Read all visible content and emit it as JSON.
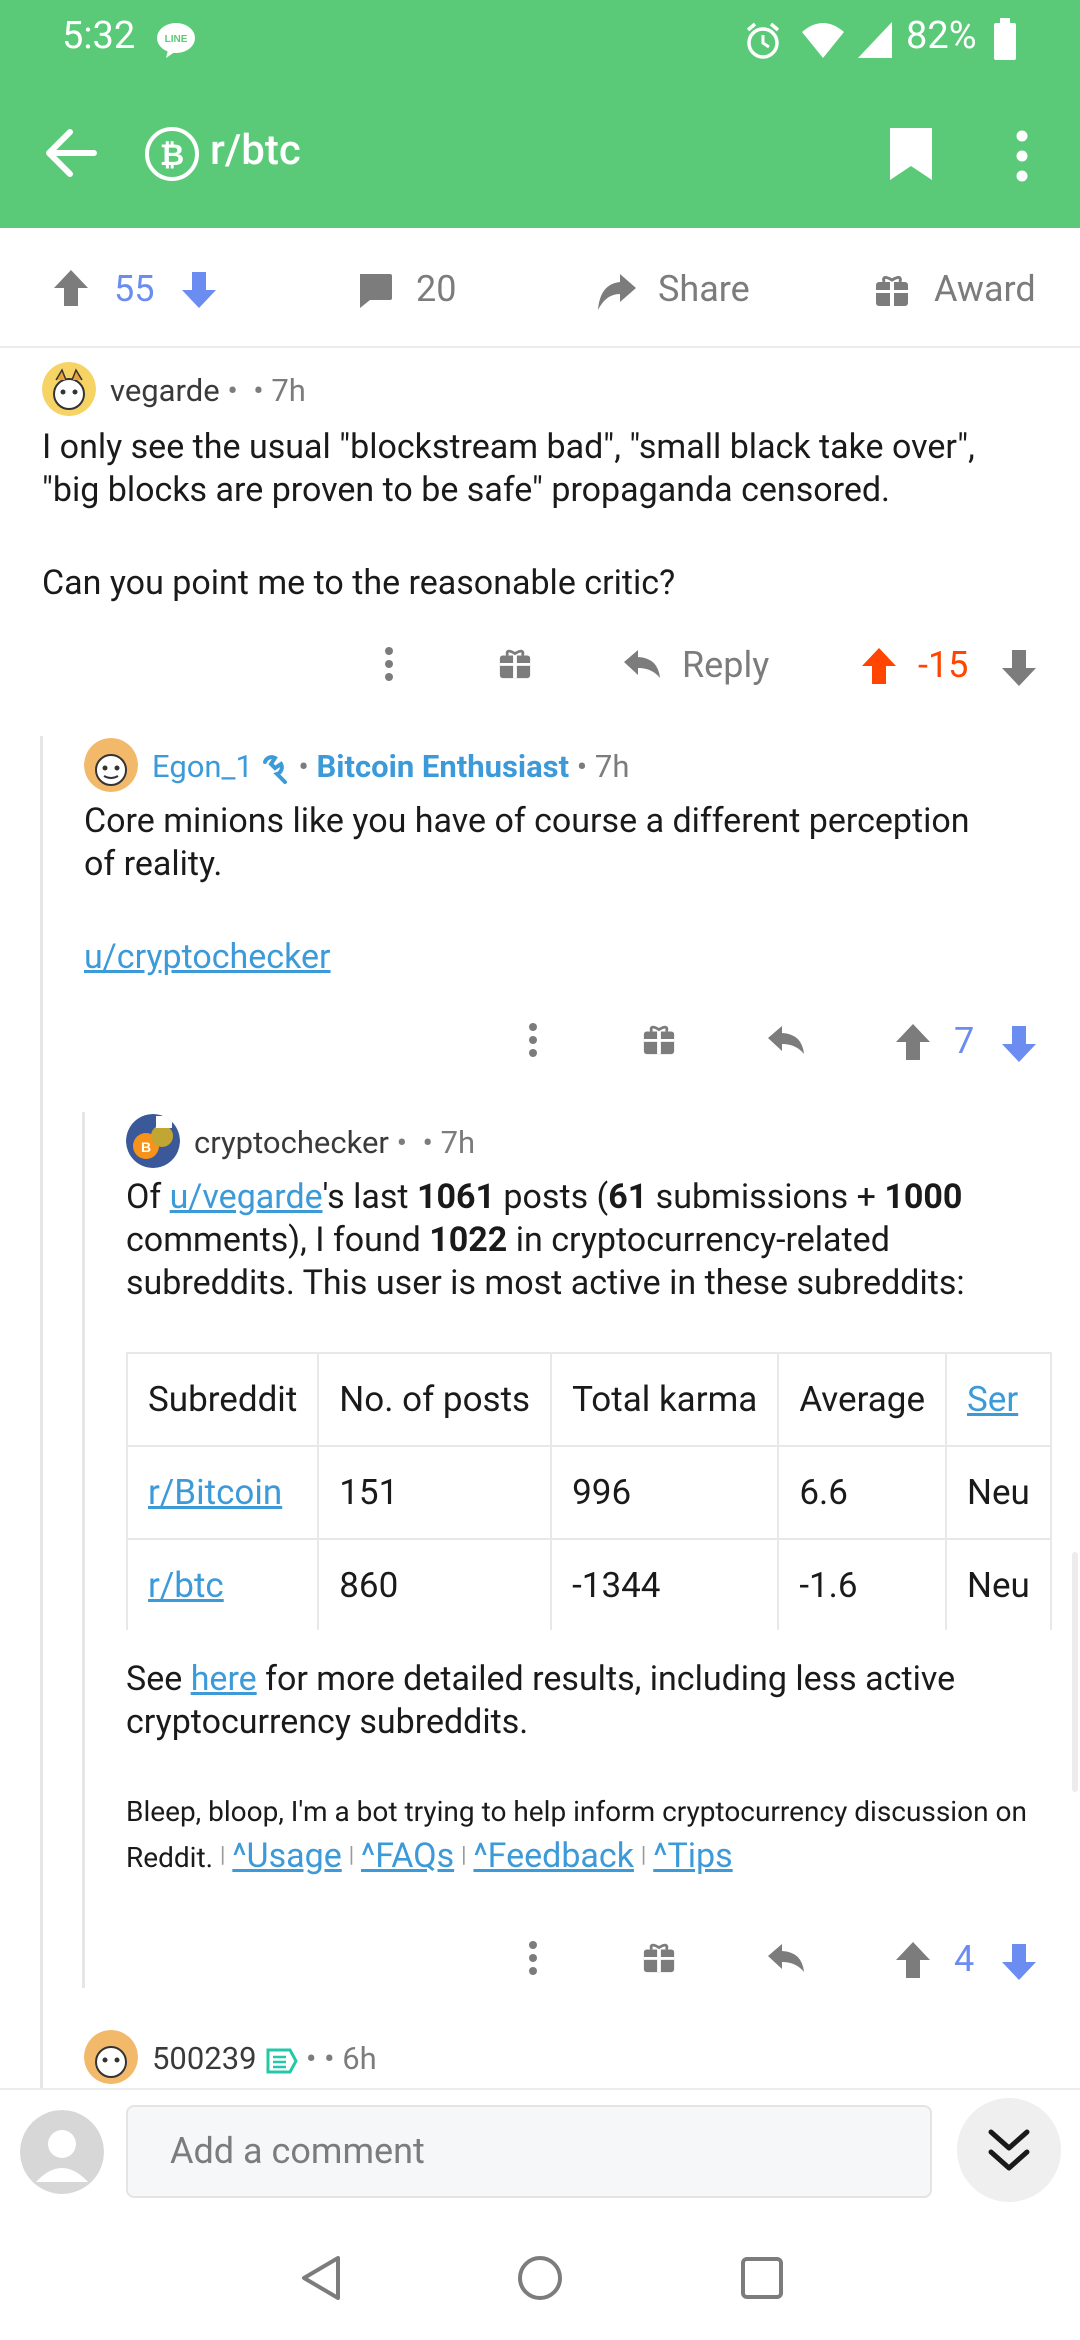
{
  "status_bar": {
    "time": "5:32",
    "battery": "82%",
    "icons": [
      "line-icon",
      "alarm-icon",
      "wifi-icon",
      "signal-icon",
      "battery-icon"
    ]
  },
  "toolbar": {
    "subreddit": "r/btc"
  },
  "post_actions": {
    "upvotes": "55",
    "comments": "20",
    "share": "Share",
    "award": "Award"
  },
  "comments": [
    {
      "author": "vegarde",
      "time": "7h",
      "body_lines": [
        "I only see the usual \"blockstream bad\", \"small black take over\",",
        "\"big blocks are proven to be safe\" propaganda censored.",
        "Can you point me to the reasonable critic?"
      ],
      "reply": "Reply",
      "score": "-15"
    },
    {
      "author": "Egon_1",
      "flair": "Bitcoin Enthusiast",
      "time": "7h",
      "body_lines": [
        "Core minions like you have of course a different perception",
        "of reality."
      ],
      "link": "u/cryptochecker",
      "score": "7"
    },
    {
      "author": "cryptochecker",
      "time": "7h",
      "intro": {
        "p1": "Of ",
        "user_link": "u/vegarde",
        "p2": "'s last ",
        "n1": "1061",
        "p3": " posts (",
        "n2": "61",
        "p4": " submissions + ",
        "n3": "1000",
        "line2a": "comments), I found ",
        "n4": "1022",
        "line2b": " in cryptocurrency-related",
        "line3": "subreddits. This user is most active in these subreddits:"
      },
      "table": {
        "headers": [
          "Subreddit",
          "No. of posts",
          "Total karma",
          "Average",
          "Ser"
        ],
        "rows": [
          [
            "r/Bitcoin",
            "151",
            "996",
            "6.6",
            "Neu"
          ],
          [
            "r/btc",
            "860",
            "-1344",
            "-1.6",
            "Neu"
          ]
        ]
      },
      "see": {
        "p1": "See ",
        "link": "here",
        "p2": " for more detailed results, including less active",
        "line2": "cryptocurrency subreddits."
      },
      "footer": {
        "line1": "Bleep, bloop, I'm a bot trying to help inform cryptocurrency discussion on",
        "line2": "Reddit.",
        "links": [
          "^Usage",
          "^FAQs",
          "^Feedback",
          "^Tips"
        ]
      },
      "score": "4"
    },
    {
      "author": "500239",
      "time": "6h"
    }
  ],
  "comment_bar": {
    "placeholder": "Add a comment"
  },
  "colors": {
    "toolbar": "#5bca78",
    "upvote_active": "#ff4500",
    "vote_blue": "#6b8cf1",
    "link": "#3d9ad9"
  }
}
